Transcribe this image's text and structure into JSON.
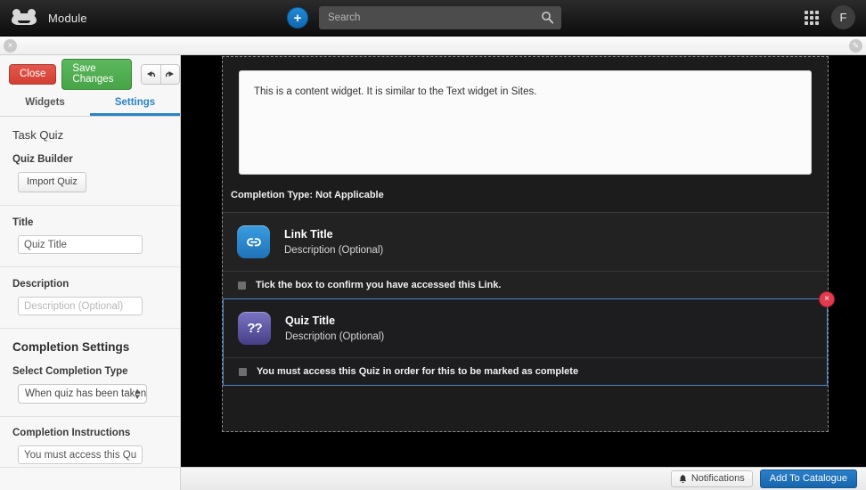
{
  "topnav": {
    "brand_title": "Module",
    "logo_icon": "frog-logo-icon",
    "add_button_label": "+",
    "search": {
      "placeholder": "Search",
      "value": "",
      "icon": "search-icon"
    },
    "apps_icon": "grid-apps-icon",
    "avatar_initial": "F"
  },
  "subbar": {
    "close_label": "×",
    "edit_label": "✎"
  },
  "left_panel": {
    "toolbar": {
      "close_label": "Close",
      "save_label": "Save Changes",
      "undo_icon": "undo-arrow-icon",
      "redo_icon": "redo-arrow-icon"
    },
    "tabs": [
      {
        "label": "Widgets",
        "active": false
      },
      {
        "label": "Settings",
        "active": true
      }
    ],
    "section_title": "Task Quiz",
    "quiz_builder": {
      "label": "Quiz Builder",
      "import_button": "Import Quiz"
    },
    "title_field": {
      "label": "Title",
      "value": "Quiz Title",
      "placeholder": "Quiz Title"
    },
    "description_field": {
      "label": "Description",
      "value": "",
      "placeholder": "Description (Optional)"
    },
    "completion_settings": {
      "heading": "Completion Settings",
      "select_label": "Select Completion Type",
      "select_value": "When quiz has been taken",
      "instructions_label": "Completion Instructions",
      "instructions_value": "You must access this Quiz in ord"
    }
  },
  "canvas": {
    "content_widget": {
      "text": "This is a content widget. It is similar to the Text widget in Sites."
    },
    "completion_type_line": "Completion Type: Not Applicable",
    "widgets": [
      {
        "icon": "link-icon",
        "title": "Link Title",
        "description": "Description (Optional)",
        "checkbox_label": "Tick the box to confirm you have accessed this Link.",
        "selected": false
      },
      {
        "icon": "quiz-question-icon",
        "title": "Quiz Title",
        "description": "Description (Optional)",
        "checkbox_label": "You must access this Quiz in order for this to be marked as complete",
        "selected": true,
        "delete_label": "×"
      }
    ]
  },
  "bottombar": {
    "notifications_label": "Notifications",
    "notifications_icon": "bell-icon",
    "add_catalogue_label": "Add To Catalogue"
  },
  "colors": {
    "accent_blue": "#2b82c9",
    "danger_red": "#e23b4e",
    "success_green": "#5cb85c",
    "link_icon_blue": "#2f8fd6",
    "quiz_icon_purple": "#5a52a0"
  }
}
